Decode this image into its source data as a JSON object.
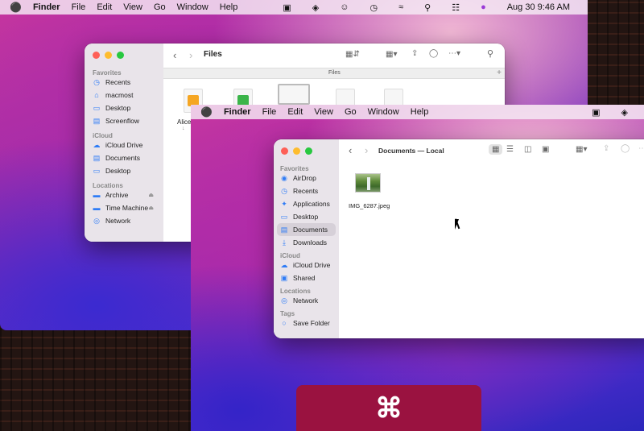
{
  "menubar1": {
    "apple": "",
    "items": [
      "Finder",
      "File",
      "Edit",
      "View",
      "Go",
      "Window",
      "Help"
    ],
    "datetime": "Aug 30  9:46 AM"
  },
  "menubar2": {
    "apple": "",
    "items": [
      "Finder",
      "File",
      "Edit",
      "View",
      "Go",
      "Window",
      "Help"
    ]
  },
  "win1": {
    "title": "Files",
    "tab": "Files",
    "add_tab": "+",
    "sections": [
      {
        "header": "Favorites",
        "items": [
          {
            "label": "Recents",
            "icon": "clock-icon"
          },
          {
            "label": "macmost",
            "icon": "house-icon"
          },
          {
            "label": "Desktop",
            "icon": "desktop-icon"
          },
          {
            "label": "Screenflow",
            "icon": "folder-icon"
          }
        ]
      },
      {
        "header": "iCloud",
        "items": [
          {
            "label": "iCloud Drive",
            "icon": "cloud-icon"
          },
          {
            "label": "Documents",
            "icon": "doc-icon"
          },
          {
            "label": "Desktop",
            "icon": "desktop-icon"
          }
        ]
      },
      {
        "header": "Locations",
        "items": [
          {
            "label": "Archive",
            "icon": "drive-icon"
          },
          {
            "label": "Time Machine",
            "icon": "drive-icon"
          },
          {
            "label": "Network",
            "icon": "globe-icon"
          }
        ]
      }
    ],
    "file_partial": "Alice",
    "file_partial_sub": "↓"
  },
  "win2": {
    "title": "Documents — Local",
    "sections": [
      {
        "header": "Favorites",
        "items": [
          {
            "label": "AirDrop",
            "icon": "airdrop-icon"
          },
          {
            "label": "Recents",
            "icon": "clock-icon"
          },
          {
            "label": "Applications",
            "icon": "apps-icon"
          },
          {
            "label": "Desktop",
            "icon": "desktop-icon"
          },
          {
            "label": "Documents",
            "icon": "doc-icon",
            "selected": true
          },
          {
            "label": "Downloads",
            "icon": "download-icon"
          }
        ]
      },
      {
        "header": "iCloud",
        "items": [
          {
            "label": "iCloud Drive",
            "icon": "cloud-icon"
          },
          {
            "label": "Shared",
            "icon": "shared-icon"
          }
        ]
      },
      {
        "header": "Locations",
        "items": [
          {
            "label": "Network",
            "icon": "globe-icon"
          }
        ]
      },
      {
        "header": "Tags",
        "items": [
          {
            "label": "Save Folder",
            "icon": "tag-icon"
          }
        ]
      }
    ],
    "file": {
      "name": "IMG_6287.jpeg"
    }
  },
  "keystroke": "⌘",
  "colors": {
    "accent": "#2f7cf6",
    "keystroke_bg": "#9a1240"
  }
}
